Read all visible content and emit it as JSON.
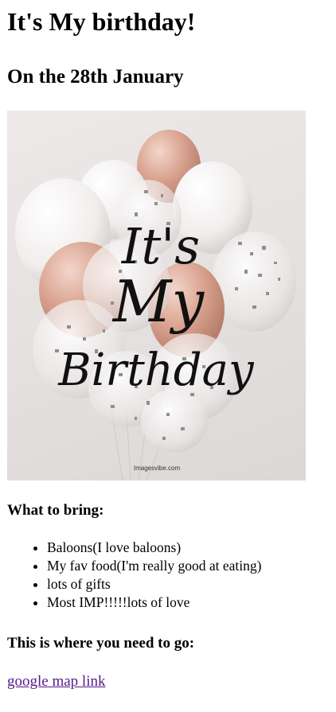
{
  "page": {
    "title": "It's My birthday!",
    "subtitle": "On the 28th January"
  },
  "image": {
    "overlay_line1": "It's",
    "overlay_line2": "My",
    "overlay_line3": "Birthday",
    "watermark": "Imagesvibe.com"
  },
  "bring": {
    "heading": "What to bring:",
    "items": [
      "Baloons(I love baloons)",
      "My fav food(I'm really good at eating)",
      "lots of gifts",
      "Most IMP!!!!!lots of love"
    ]
  },
  "location": {
    "heading": "This is where you need to go:",
    "link_text": "google map link"
  },
  "colors": {
    "link_visited": "#551a8b",
    "balloon_white": "#f7f5f4",
    "balloon_rose": "#d9a390",
    "confetti": "#9a9a9a"
  }
}
